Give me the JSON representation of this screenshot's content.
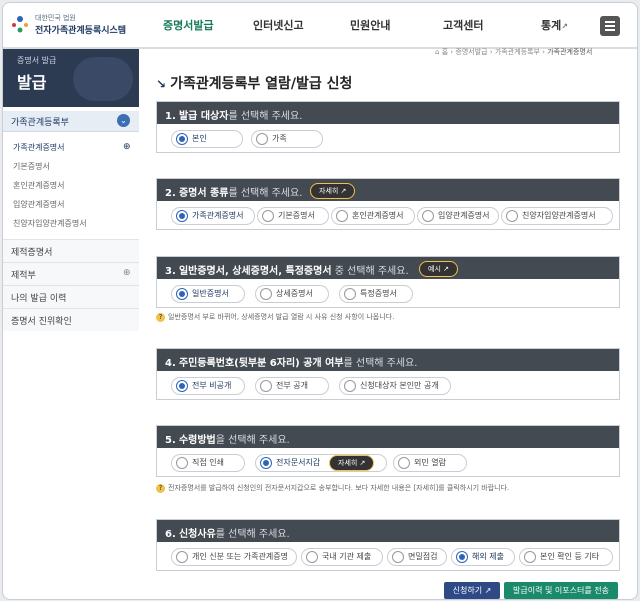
{
  "header": {
    "org_small": "대한민국 법원",
    "org_name": "전자가족관계등록시스템",
    "nav": [
      "증명서발급",
      "인터넷신고",
      "민원안내",
      "고객센터",
      "통계"
    ],
    "nav_ext": "↗"
  },
  "sidebar": {
    "banner_small": "증명서 발급",
    "banner_big": "발급",
    "group_title": "가족관계등록부",
    "subitems": [
      "가족관계증명서",
      "기본증명서",
      "혼인관계증명서",
      "입양관계증명서",
      "친양자입양관계증명서"
    ],
    "items": [
      "제적증명서",
      "제적부",
      "나의 발급 이력",
      "증명서 진위확인"
    ]
  },
  "breadcrumb": [
    "홈",
    "증명서발급",
    "가족관계등록부",
    "가족관계증명서"
  ],
  "page_title": "가족관계등록부 열람/발급 신청",
  "sections": [
    {
      "num": "1.",
      "bold": "발급 대상자",
      "rest": "를 선택해 주세요.",
      "options": [
        "본인",
        "가족"
      ],
      "selected": 0
    },
    {
      "num": "2.",
      "bold": "증명서 종류",
      "rest": "를 선택해 주세요.",
      "pill": "자세히 ↗",
      "options": [
        "가족관계증명서",
        "기본증명서",
        "혼인관계증명서",
        "입양관계증명서",
        "친양자입양관계증명서"
      ],
      "selected": 0
    },
    {
      "num": "3.",
      "bold": "일반증명서, 상세증명서, 특정증명서",
      "rest": " 중 선택해 주세요.",
      "pill": "예시 ↗",
      "options": [
        "일반증명서",
        "상세증명서",
        "특정증명서"
      ],
      "selected": 0
    },
    {
      "num": "4.",
      "bold": "주민등록번호(뒷부분 6자리) 공개 여부",
      "rest": "를 선택해 주세요.",
      "options": [
        "전부 비공개",
        "전부 공개",
        "신청대상자 본인만 공개"
      ],
      "selected": 0
    },
    {
      "num": "5.",
      "bold": "수령방법",
      "rest": "을 선택해 주세요.",
      "options": [
        "직접 인쇄",
        "전자문서지갑",
        "외민 열람"
      ],
      "selected": 1,
      "pill": "자세히 ↗"
    },
    {
      "num": "6.",
      "bold": "신청사유",
      "rest": "를 선택해 주세요.",
      "options": [
        "개인 신분 또는 가족관계증명",
        "국내 기관 제출",
        "면밀점검",
        "해외 제출",
        "본인 확인 등 기타"
      ],
      "selected": 3
    }
  ],
  "notes": [
    "일반증명서 부로 바뀌어, 상세증명서 발급 열람 시 사유 신청 사항이 나옵니다.",
    "전자증명서를 발급하여 신청인의 전자문서지갑으로 송부합니다. 보다 자세한 내용은 [자세히]를 클릭하시기 바랍니다."
  ],
  "buttons": {
    "apply": "신청하기 ↗",
    "history": "발급이력 및 이포스터를 전송"
  },
  "colors": {
    "accent": "#1a7a5c",
    "header_bar": "#444a51",
    "primary": "#2e4a86",
    "success": "#1a8a6a"
  }
}
